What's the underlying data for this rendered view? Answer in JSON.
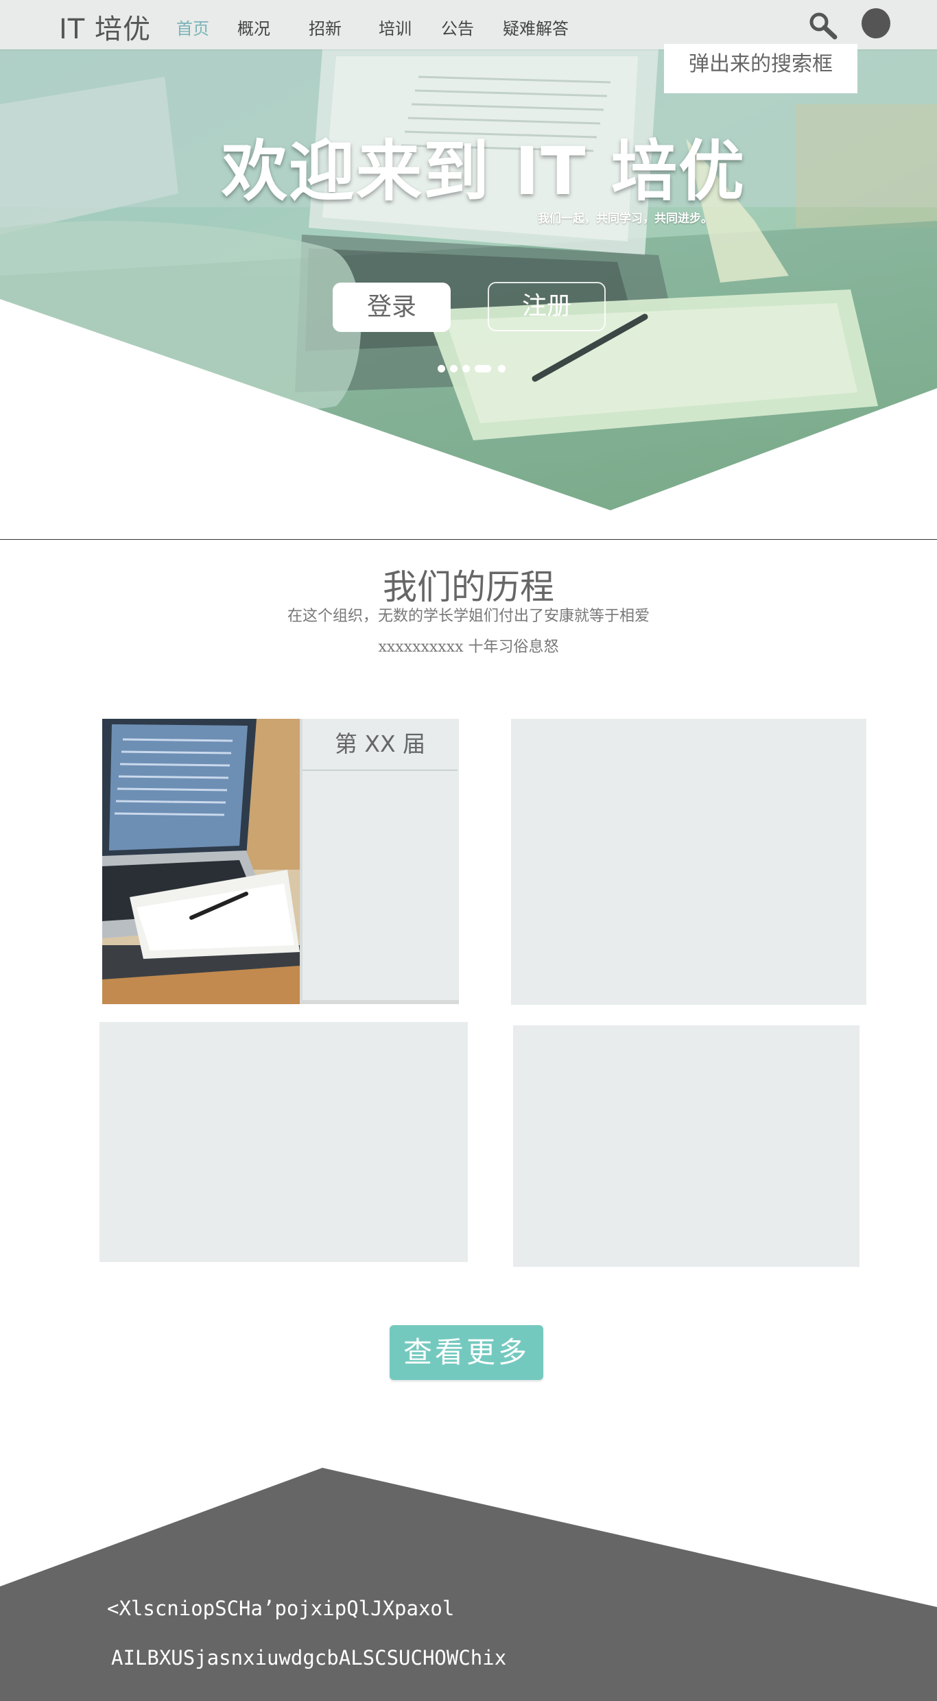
{
  "nav": {
    "brand": "IT 培优",
    "items": [
      "首页",
      "概况",
      "招新",
      "培训",
      "公告",
      "疑难解答"
    ],
    "active_index": 0,
    "search_icon": "search-icon",
    "avatar_icon": "avatar"
  },
  "search_popup": {
    "label": "弹出来的搜索框"
  },
  "hero": {
    "title": "欢迎来到 IT 培优",
    "subtitle": "我们一起，共同学习，共同进步。",
    "login_label": "登录",
    "register_label": "注册",
    "carousel_dots": 5,
    "carousel_active": 3
  },
  "history": {
    "title": "我们的历程",
    "desc_line1": "在这个组织，无数的学长学姐们付出了安康就等于相爱",
    "desc_line2": "xxxxxxxxxx 十年习俗息怒",
    "card1_title": "第 XX 届"
  },
  "more_button": {
    "label": "查看更多"
  },
  "footer": {
    "line1": "<XlscniopSCHa’pojxipQlJXpaxol",
    "line2": "AILBXUSjasnxiuwdgcbALSCSUCHOWChix"
  },
  "colors": {
    "accent": "#74c9bf",
    "nav_active": "#7ab3b8",
    "nav_bg": "#e8ebe9",
    "card_bg": "#e8ecec",
    "footer_bg": "#666666"
  }
}
